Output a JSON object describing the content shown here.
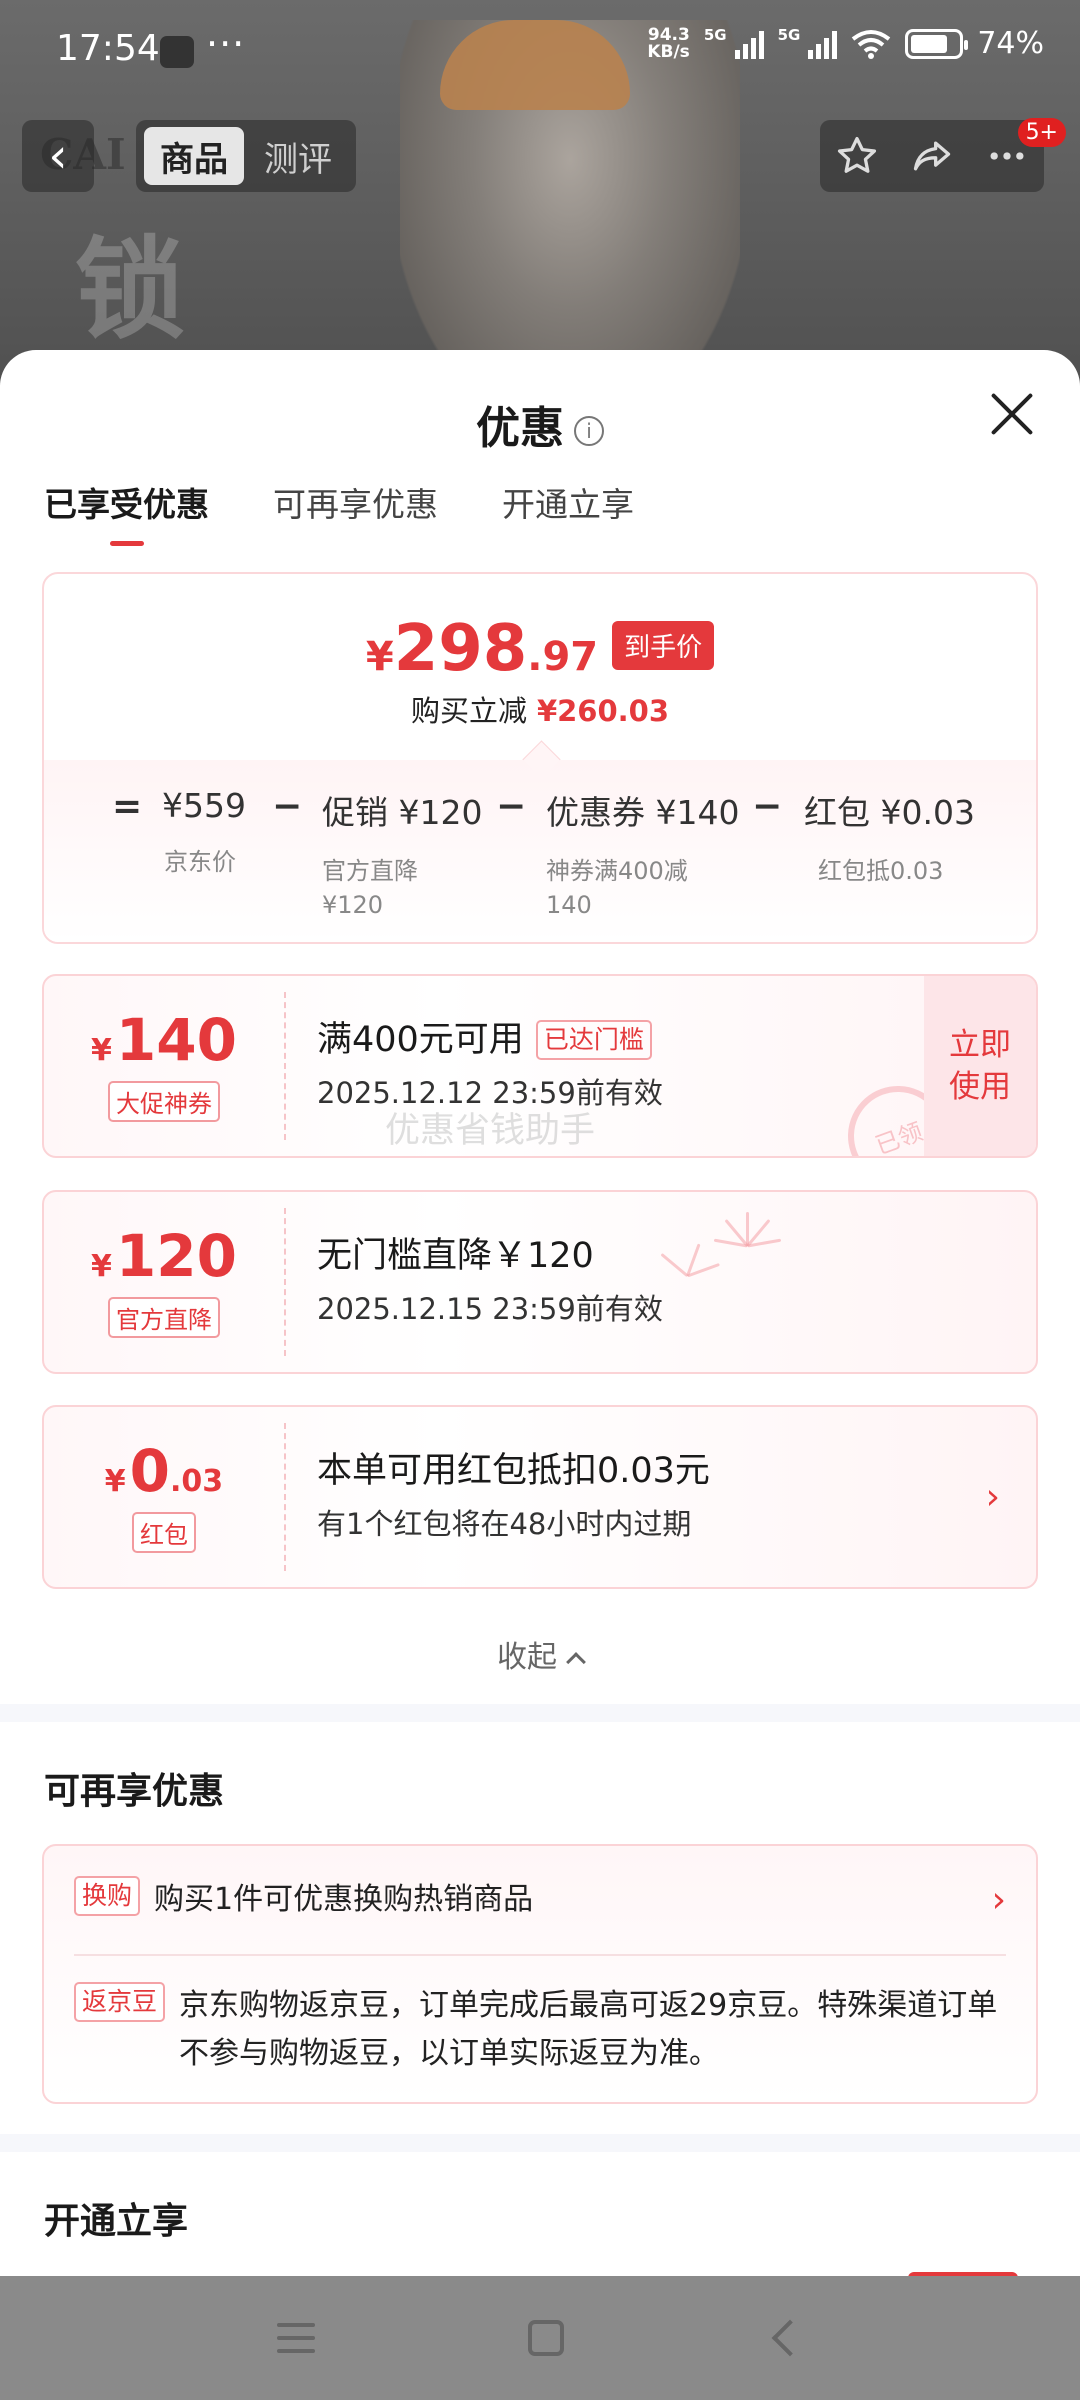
{
  "status_bar": {
    "time": "17:54",
    "more": "···",
    "net_speed_value": "94.3",
    "net_speed_unit": "KB/s",
    "sig1_label": "5G",
    "sig2_label": "5G",
    "battery": "74%"
  },
  "product_nav": {
    "back_icon": "‹",
    "tabs": [
      "商品",
      "测评"
    ],
    "badge": "5+",
    "brand_text": "CAI",
    "bg_text": "锁"
  },
  "sheet": {
    "title": "优惠",
    "info_icon": "i",
    "tabs": [
      "已享受优惠",
      "可再享优惠",
      "开通立享"
    ]
  },
  "summary": {
    "price_yen": "¥",
    "price_int": "298",
    "price_dec": ".97",
    "price_tag": "到手价",
    "reduce_label": "购买立减",
    "reduce_amount": "¥260.03",
    "calc": [
      {
        "op": "=",
        "value": "¥559",
        "sub": "京东价"
      },
      {
        "op": "−",
        "value": "促销 ¥120",
        "sub": "官方直降\n¥120"
      },
      {
        "op": "−",
        "value": "优惠券 ¥140",
        "sub": "神券满400减\n140"
      },
      {
        "op": "−",
        "value": "红包 ¥0.03",
        "sub": "红包抵0.03"
      }
    ]
  },
  "coupons": [
    {
      "yen": "¥",
      "amount": "140",
      "decimal": "",
      "label": "大促神券",
      "main": "满400元可用",
      "tag": "已达门槛",
      "sub": "2025.12.12 23:59前有效",
      "action": "立即\n使用",
      "stamp": "已领"
    },
    {
      "yen": "¥",
      "amount": "120",
      "decimal": "",
      "label": "官方直降",
      "main": "无门槛直降￥120",
      "sub": "2025.12.15 23:59前有效"
    },
    {
      "yen": "¥",
      "amount": "0",
      "decimal": ".03",
      "label": "红包",
      "main": "本单可用红包抵扣0.03元",
      "sub": "有1个红包将在48小时内过期",
      "chevron": "›"
    }
  ],
  "watermark": "优惠省钱助手",
  "collapse_label": "收起",
  "more_section": {
    "title": "可再享优惠",
    "rows": [
      {
        "tag": "换购",
        "text": "购买1件可优惠换购热销商品",
        "chevron": "›"
      },
      {
        "tag": "返京豆",
        "text": "京东购物返京豆，订单完成后最高可返29京豆。特殊渠道订单不参与购物返豆，以订单实际返豆为准。"
      }
    ]
  },
  "open_section": {
    "title": "开通立享"
  },
  "colors": {
    "accent": "#e4393c",
    "card_border": "#fbd3d6"
  },
  "icons": [
    "info-icon",
    "close-icon",
    "star-icon",
    "share-icon",
    "more-icon",
    "back-icon",
    "chevron-right-icon",
    "chevron-up-icon"
  ]
}
